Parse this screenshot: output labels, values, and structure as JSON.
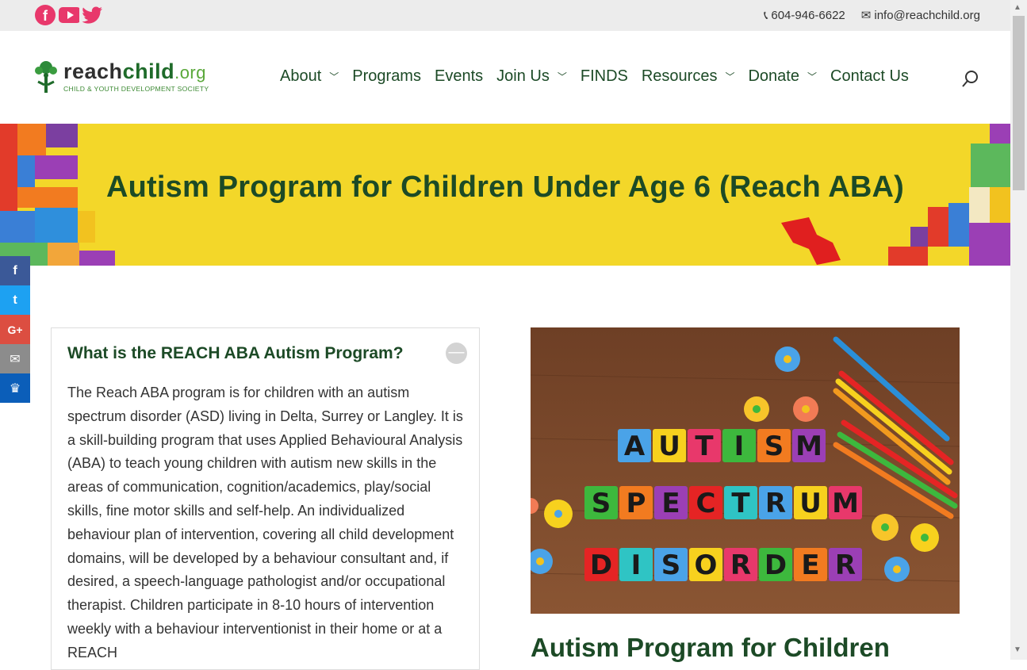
{
  "topbar": {
    "phone": "604-946-6622",
    "email": "info@reachchild.org",
    "social": [
      "facebook-icon",
      "youtube-icon",
      "twitter-icon"
    ],
    "social_color": "#e8386b"
  },
  "logo": {
    "name_part1": "reach",
    "name_part2": "child",
    "name_part3": ".org",
    "tagline": "CHILD & YOUTH DEVELOPMENT SOCIETY"
  },
  "nav": {
    "items": [
      {
        "label": "About",
        "dropdown": true
      },
      {
        "label": "Programs",
        "dropdown": false
      },
      {
        "label": "Events",
        "dropdown": false
      },
      {
        "label": "Join Us",
        "dropdown": true
      },
      {
        "label": "FINDS",
        "dropdown": false
      },
      {
        "label": "Resources",
        "dropdown": true
      },
      {
        "label": "Donate",
        "dropdown": true
      },
      {
        "label": "Contact Us",
        "dropdown": false
      }
    ]
  },
  "banner": {
    "title": "Autism Program for Children Under Age 6 (Reach ABA)"
  },
  "share": [
    {
      "icon": "facebook-icon",
      "glyph": "f",
      "color": "#3b5998"
    },
    {
      "icon": "twitter-icon",
      "glyph": "t",
      "color": "#1da1f2"
    },
    {
      "icon": "google-plus-icon",
      "glyph": "G+",
      "color": "#dc4e41"
    },
    {
      "icon": "email-icon",
      "glyph": "✉",
      "color": "#8c8c8c"
    },
    {
      "icon": "sumome-icon",
      "glyph": "♛",
      "color": "#0b5eb9"
    }
  ],
  "accordion": {
    "title": "What is the REACH ABA Autism Program?",
    "toggle": "—",
    "body": "The Reach ABA program is for children with an autism spectrum disorder (ASD) living in Delta, Surrey or Langley. It is a skill-building program that uses Applied Behavioural Analysis (ABA) to teach young children with autism new skills in the areas of communication, cognition/academics, play/social skills, fine motor skills and self-help. An individualized behaviour plan of intervention, covering all child development domains, will be developed by a behaviour consultant and, if desired, a speech-language pathologist and/or occupational therapist. Children participate in 8-10 hours of intervention weekly with a behaviour interventionist in their home or at a REACH"
  },
  "photo": {
    "rows": [
      "AUTISM",
      "SPECTRUM",
      "DISORDER"
    ]
  },
  "right_heading": "Autism Program for Children"
}
